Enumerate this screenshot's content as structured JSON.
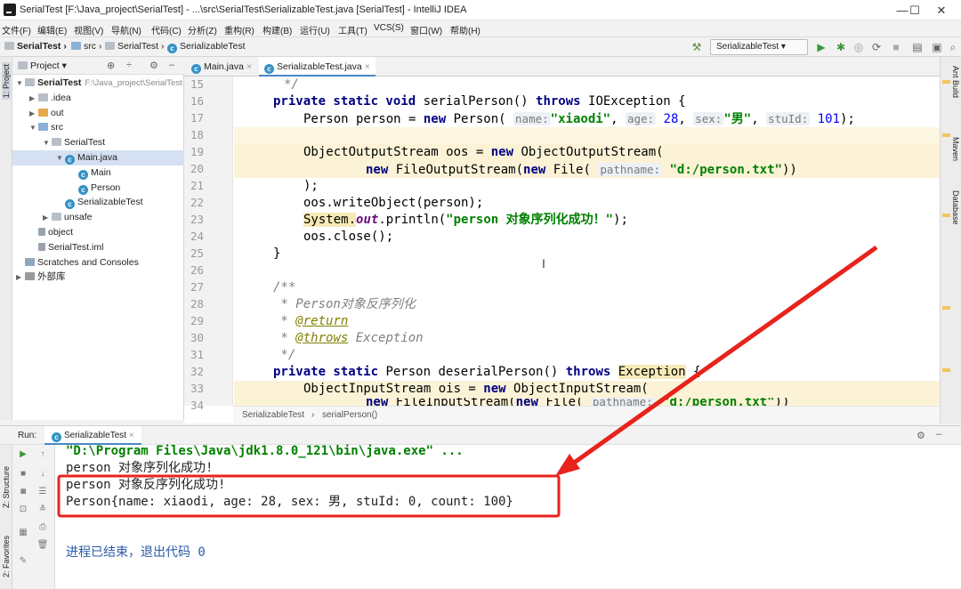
{
  "window": {
    "title": "SerialTest [F:\\Java_project\\SerialTest] - ...\\src\\SerialTest\\SerializableTest.java [SerialTest] - IntelliJ IDEA",
    "minimize": "—",
    "maximize": "☐",
    "close": "✕"
  },
  "menu": [
    "文件(F)",
    "编辑(E)",
    "视图(V)",
    "导航(N)",
    "代码(C)",
    "分析(Z)",
    "重构(R)",
    "构建(B)",
    "运行(U)",
    "工具(T)",
    "VCS(S)",
    "窗口(W)",
    "帮助(H)"
  ],
  "breadcrumb": {
    "project": "SerialTest",
    "src": "src",
    "package": "SerialTest",
    "file": "SerializableTest"
  },
  "run_config": "SerializableTest",
  "project_panel": {
    "title": "Project",
    "tree": [
      {
        "label": "SerialTest",
        "extra": "F:\\Java_project\\SerialTest",
        "indent": 0,
        "arrow": "▼",
        "icon": "folder",
        "bold": true
      },
      {
        "label": ".idea",
        "indent": 1,
        "arrow": "▶",
        "icon": "folder"
      },
      {
        "label": "out",
        "indent": 1,
        "arrow": "▶",
        "icon": "folder-orange"
      },
      {
        "label": "src",
        "indent": 1,
        "arrow": "▼",
        "icon": "folder-blue"
      },
      {
        "label": "SerialTest",
        "indent": 2,
        "arrow": "▼",
        "icon": "package"
      },
      {
        "label": "Main.java",
        "indent": 3,
        "arrow": "▼",
        "icon": "class",
        "selected": true
      },
      {
        "label": "Main",
        "indent": 4,
        "arrow": "",
        "icon": "class"
      },
      {
        "label": "Person",
        "indent": 4,
        "arrow": "",
        "icon": "class"
      },
      {
        "label": "SerializableTest",
        "indent": 3,
        "arrow": "",
        "icon": "class"
      },
      {
        "label": "unsafe",
        "indent": 2,
        "arrow": "▶",
        "icon": "package"
      },
      {
        "label": "object",
        "indent": 1,
        "arrow": "",
        "icon": "file"
      },
      {
        "label": "SerialTest.iml",
        "indent": 1,
        "arrow": "",
        "icon": "file"
      },
      {
        "label": "Scratches and Consoles",
        "indent": 0,
        "arrow": "",
        "icon": "scratch"
      },
      {
        "label": "外部库",
        "indent": 0,
        "arrow": "▶",
        "icon": "lib"
      }
    ]
  },
  "left_strip": {
    "project": "1: Project",
    "structure": "Z: Structure",
    "favorites": "2: Favorites"
  },
  "right_strip": {
    "ant": "Ant Build",
    "maven": "Maven",
    "database": "Database"
  },
  "editor_tabs": [
    {
      "label": "Main.java",
      "active": false
    },
    {
      "label": "SerializableTest.java",
      "active": true
    }
  ],
  "editor_crumb": [
    "SerializableTest",
    "serialPerson()"
  ],
  "line_numbers": [
    "15",
    "16",
    "17",
    "18",
    "19",
    "20",
    "21",
    "22",
    "23",
    "24",
    "25",
    "26",
    "27",
    "28",
    "29",
    "30",
    "31",
    "32",
    "33",
    "34"
  ],
  "code": {
    "l15": "*/",
    "l16": {
      "kw": "private static void",
      "name": " serialPerson() ",
      "kw2": "throws",
      "rest": " IOException {"
    },
    "l17": {
      "pre": "Person person = ",
      "kw": "new",
      "call": " Person(",
      "h1": "name:",
      "s1": "\"xiaodi\"",
      "c1": ", ",
      "h2": "age:",
      "n1": "28",
      "c2": ", ",
      "h3": "sex:",
      "s2": "\"男\"",
      "c3": ", ",
      "h4": "stuId:",
      "n2": "101",
      "end": ");"
    },
    "l19": {
      "pre": "ObjectOutputStream oos = ",
      "kw": "new",
      "rest": " ObjectOutputStream("
    },
    "l20": {
      "kw": "new",
      "mid": " FileOutputStream(",
      "kw2": "new",
      "mid2": " File(",
      "hint": "pathname:",
      "s": "\"d:/person.txt\"",
      "end": "))"
    },
    "l21": ");",
    "l22": "oos.writeObject(person);",
    "l23": {
      "sys": "System.",
      "fld": "out",
      "call": ".println(",
      "s": "\"person 对象序列化成功！\"",
      "end": ");"
    },
    "l24": "oos.close();",
    "l25": "}",
    "l27": "/**",
    "l28": " * Person对象反序列化",
    "l29": {
      "star": " * ",
      "ann": "@return"
    },
    "l30": {
      "star": " * ",
      "ann": "@throws",
      "rest": " Exception"
    },
    "l31": " */",
    "l32": {
      "kw": "private static",
      "name": " Person deserialPerson() ",
      "kw2": "throws",
      "rest": " ",
      "exc": "Exception",
      "end": " {"
    },
    "l33": {
      "pre": "ObjectInputStream ois = ",
      "kw": "new",
      "rest": " ObjectInputStream("
    },
    "l34": {
      "kw": "new",
      "mid": " FileInputStream(",
      "kw2": "new",
      "mid2": " File(",
      "hint": "pathname:",
      "s": "\"d:/person.txt\"",
      "end": "))"
    }
  },
  "run": {
    "label": "Run:",
    "tab": "SerializableTest",
    "lines": [
      "\"D:\\Program Files\\Java\\jdk1.8.0_121\\bin\\java.exe\" ...",
      "person 对象序列化成功!",
      "person 对象反序列化成功!",
      "Person{name: xiaodi, age: 28, sex: 男, stuId: 0, count: 100}",
      "进程已结束，退出代码 0"
    ]
  },
  "colors": {
    "annotation": "#e8231c",
    "keyword": "#000080",
    "string": "#008000"
  }
}
